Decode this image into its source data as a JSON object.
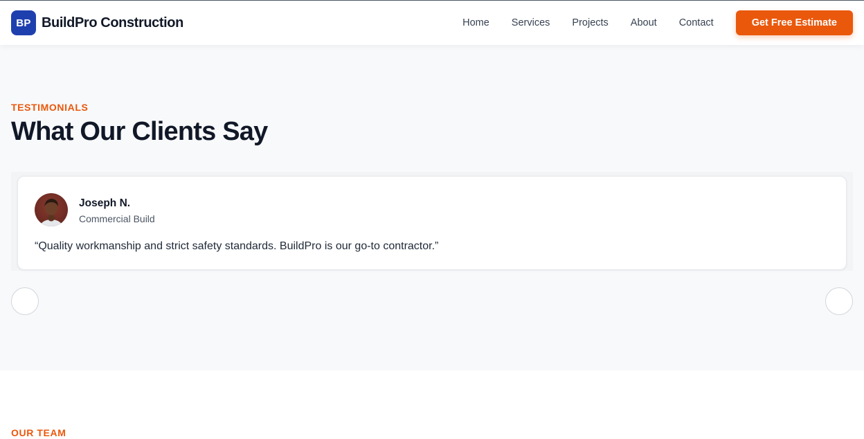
{
  "nav": {
    "logo_initials": "BP",
    "brand_name": "BuildPro Construction",
    "links": [
      "Home",
      "Services",
      "Projects",
      "About",
      "Contact"
    ],
    "cta_label": "Get Free Estimate"
  },
  "testimonials": {
    "eyebrow": "TESTIMONIALS",
    "title": "What Our Clients Say",
    "items": [
      {
        "name": "Joseph N.",
        "role": "Commercial Build",
        "quote": "“Quality workmanship and strict safety standards. BuildPro is our go-to contractor.”"
      }
    ],
    "controls": {
      "prev_icon": "chevron-left-icon",
      "next_icon": "chevron-right-icon"
    }
  },
  "team": {
    "eyebrow": "OUR TEAM"
  },
  "colors": {
    "primary": "#1e40af",
    "accent": "#ea580c",
    "section_bg": "#f8f9fb",
    "text_dark": "#111827"
  }
}
